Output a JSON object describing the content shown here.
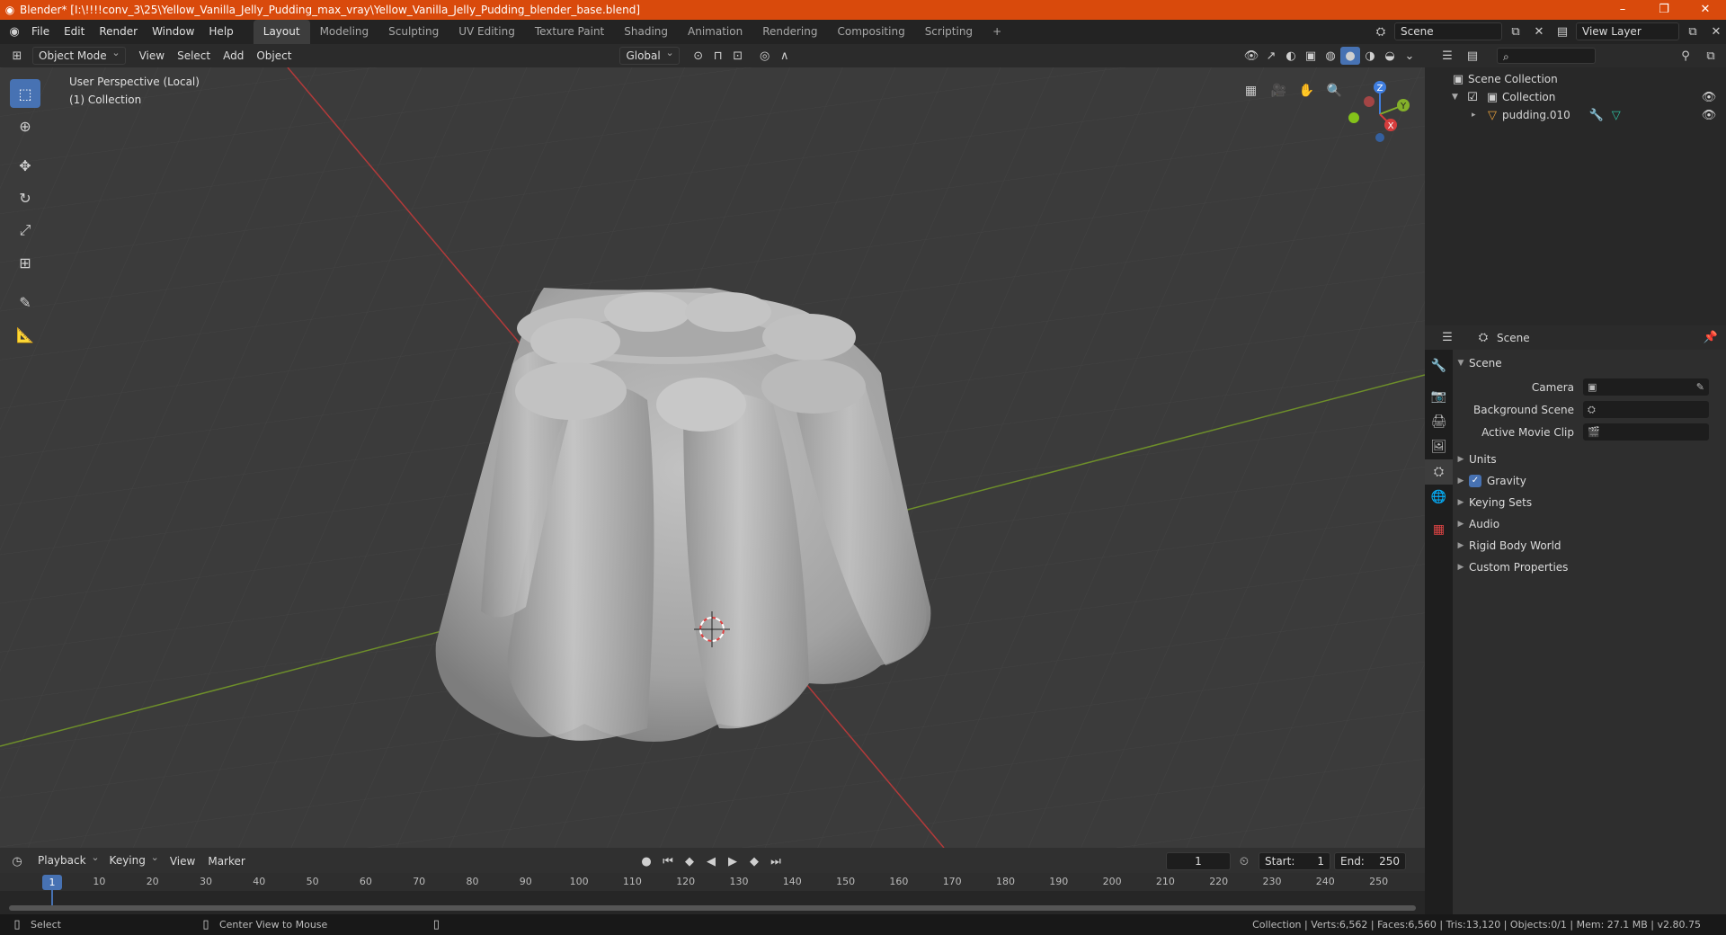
{
  "window": {
    "title": "Blender* [I:\\!!!!conv_3\\25\\Yellow_Vanilla_Jelly_Pudding_max_vray\\Yellow_Vanilla_Jelly_Pudding_blender_base.blend]",
    "minimize": "–",
    "maximize": "❐",
    "close": "✕"
  },
  "menu": [
    "File",
    "Edit",
    "Render",
    "Window",
    "Help"
  ],
  "workspaces": [
    "Layout",
    "Modeling",
    "Sculpting",
    "UV Editing",
    "Texture Paint",
    "Shading",
    "Animation",
    "Rendering",
    "Compositing",
    "Scripting"
  ],
  "active_workspace": "Layout",
  "add_workspace": "+",
  "scene_field": "Scene",
  "view_layer_field": "View Layer",
  "viewport_header": {
    "mode": "Object Mode",
    "menus": [
      "View",
      "Select",
      "Add",
      "Object"
    ],
    "orientation": "Global"
  },
  "viewport": {
    "perspective": "User Perspective (Local)",
    "collection": "(1) Collection",
    "gizmo": {
      "x": "X",
      "y": "Y",
      "z": "Z"
    }
  },
  "outliner": {
    "search_placeholder": "",
    "scene_collection": "Scene Collection",
    "collection": "Collection",
    "object": "pudding.010"
  },
  "properties": {
    "header_title": "Scene",
    "section": "Scene",
    "rows": {
      "camera": "Camera",
      "background_scene": "Background Scene",
      "active_movie_clip": "Active Movie Clip"
    },
    "collapsed": [
      "Units",
      "Gravity",
      "Keying Sets",
      "Audio",
      "Rigid Body World",
      "Custom Properties"
    ],
    "gravity_checked": true
  },
  "timeline": {
    "menus": [
      "Playback",
      "Keying",
      "View",
      "Marker"
    ],
    "current_frame": "1",
    "start_label": "Start:",
    "start_value": "1",
    "end_label": "End:",
    "end_value": "250",
    "ruler": [
      "10",
      "20",
      "30",
      "40",
      "50",
      "60",
      "70",
      "80",
      "90",
      "100",
      "110",
      "120",
      "130",
      "140",
      "150",
      "160",
      "170",
      "180",
      "190",
      "200",
      "210",
      "220",
      "230",
      "240",
      "250"
    ],
    "ruler_current": "1"
  },
  "statusbar": {
    "left_action": "Select",
    "middle_action": "Center View to Mouse",
    "stats": "Collection | Verts:6,562 | Faces:6,560 | Tris:13,120 | Objects:0/1 | Mem: 27.1 MB | v2.80.75"
  },
  "colors": {
    "titlebar": "#d94a0c",
    "accent": "#4772b3",
    "x_axis": "#d63c3c",
    "y_axis": "#84b02a",
    "z_axis": "#3f7ee0"
  }
}
